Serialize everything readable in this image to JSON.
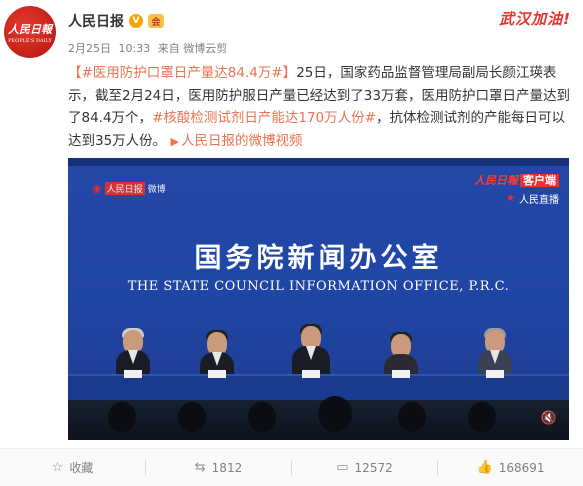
{
  "header": {
    "logo_cn": "人民日報",
    "logo_en": "PEOPLE'S DAILY",
    "username": "人民日报",
    "verified_symbol": "V",
    "vip_symbol": "会",
    "date": "2月25日",
    "time": "10:33",
    "source": "来自 微博云剪",
    "badge": "武汉加油!"
  },
  "post": {
    "tag1": "【#医用防护口罩日产量达84.4万#】",
    "text1": "25日，国家药品监督管理局副局长颜江瑛表示，截至2月24日，医用防护服日产量已经达到了33万套，医用防护口罩日产量达到了84.4万个，",
    "tag2": "#核酸检测试剂日产能达170万人份#",
    "text2": "，抗体检测试剂的产能每日可以达到35万人份。",
    "video_link": "人民日报的微博视频"
  },
  "video": {
    "watermark_weibo": "微博",
    "watermark_source": "人民日报",
    "people_logo": "人民日報",
    "client_label": "客户端",
    "live_label": "人民直播",
    "office_cn": "国务院新闻办公室",
    "office_en": "THE STATE COUNCIL INFORMATION OFFICE, P.R.C."
  },
  "actions": {
    "favorite_label": "收藏",
    "repost_count": "1812",
    "comment_count": "12572",
    "like_count": "168691"
  },
  "icons": {
    "favorite": "star-outline-icon",
    "repost": "repost-icon",
    "comment": "comment-icon",
    "like": "thumbs-up-icon",
    "mute": "mute-icon"
  },
  "colors": {
    "link": "#eb7350",
    "brand_red": "#e8322b",
    "video_bg": "#1f45a5"
  }
}
